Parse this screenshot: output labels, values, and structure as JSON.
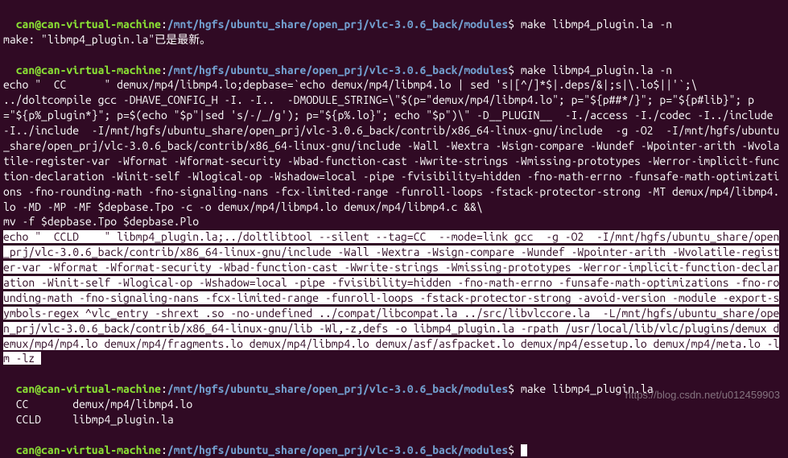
{
  "prompt": {
    "user_host": "can@can-virtual-machine",
    "colon": ":",
    "path": "/mnt/hgfs/ubuntu_share/open_prj/vlc-3.0.6_back/modules",
    "dollar": "$"
  },
  "cmd1": " make libmp4_plugin.la -n",
  "line2": "make: \"libmp4_plugin.la\"已是最新。",
  "cmd2": " make libmp4_plugin.la -n",
  "block1_l1": "echo \"  CC      \" demux/mp4/libmp4.lo;depbase=`echo demux/mp4/libmp4.lo | sed 's|[^/]*$|.deps/&|;s|\\.lo$||'`;\\",
  "block1_l2": "../doltcompile gcc -DHAVE_CONFIG_H -I. -I..  -DMODULE_STRING=\\\"$(p=\"demux/mp4/libmp4.lo\"; p=\"${p##*/}\"; p=\"${p#lib}\"; p=\"${p%_plugin*}\"; p=$(echo \"$p\"|sed 's/-/_/g'); p=\"${p%.lo}\"; echo \"$p\")\\\" -D__PLUGIN__  -I./access -I./codec -I../include -I../include  -I/mnt/hgfs/ubuntu_share/open_prj/vlc-3.0.6_back/contrib/x86_64-linux-gnu/include  -g -O2  -I/mnt/hgfs/ubuntu_share/open_prj/vlc-3.0.6_back/contrib/x86_64-linux-gnu/include -Wall -Wextra -Wsign-compare -Wundef -Wpointer-arith -Wvolatile-register-var -Wformat -Wformat-security -Wbad-function-cast -Wwrite-strings -Wmissing-prototypes -Werror-implicit-function-declaration -Winit-self -Wlogical-op -Wshadow=local -pipe -fvisibility=hidden -fno-math-errno -funsafe-math-optimizations -fno-rounding-math -fno-signaling-nans -fcx-limited-range -funroll-loops -fstack-protector-strong -MT demux/mp4/libmp4.lo -MD -MP -MF $depbase.Tpo -c -o demux/mp4/libmp4.lo demux/mp4/libmp4.c &&\\",
  "block1_l3": "mv -f $depbase.Tpo $depbase.Plo",
  "sel_block": "echo \"  CCLD    \" libmp4_plugin.la;../doltlibtool --silent --tag=CC  --mode=link gcc  -g -O2  -I/mnt/hgfs/ubuntu_share/open_prj/vlc-3.0.6_back/contrib/x86_64-linux-gnu/include -Wall -Wextra -Wsign-compare -Wundef -Wpointer-arith -Wvolatile-register-var -Wformat -Wformat-security -Wbad-function-cast -Wwrite-strings -Wmissing-prototypes -Werror-implicit-function-declaration -Winit-self -Wlogical-op -Wshadow=local -pipe -fvisibility=hidden -fno-math-errno -funsafe-math-optimizations -fno-rounding-math -fno-signaling-nans -fcx-limited-range -funroll-loops -fstack-protector-strong -avoid-version -module -export-symbols-regex ^vlc_entry -shrext .so -no-undefined ../compat/libcompat.la ../src/libvlccore.la  -L/mnt/hgfs/ubuntu_share/open_prj/vlc-3.0.6_back/contrib/x86_64-linux-gnu/lib -Wl,-z,defs -o libmp4_plugin.la -rpath /usr/local/lib/vlc/plugins/demux demux/mp4/mp4.lo demux/mp4/fragments.lo demux/mp4/libmp4.lo demux/asf/asfpacket.lo demux/mp4/essetup.lo demux/mp4/meta.lo -lm -lz ",
  "cmd3": " make libmp4_plugin.la",
  "out_l1": "  CC       demux/mp4/libmp4.lo",
  "out_l2": "  CCLD     libmp4_plugin.la",
  "watermark": "https://blog.csdn.net/u012459903"
}
